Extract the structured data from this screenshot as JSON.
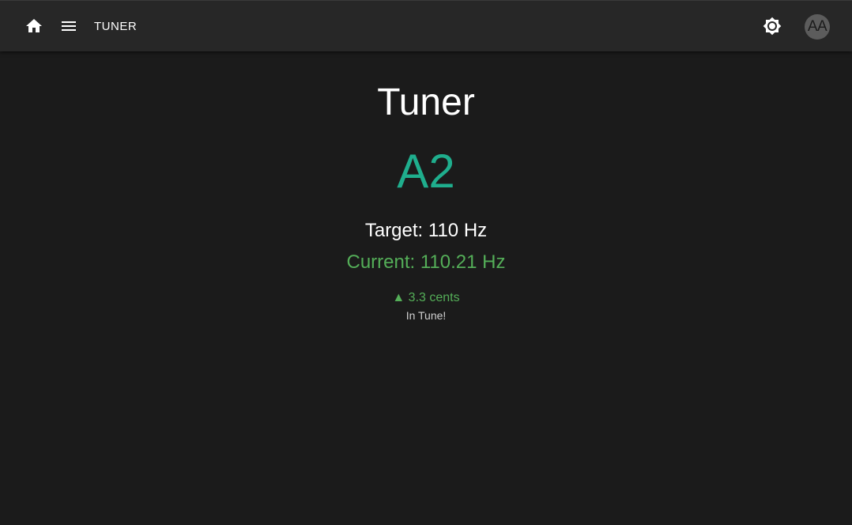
{
  "appbar": {
    "title": "TUNER",
    "home_icon": "home-icon",
    "menu_icon": "menu-icon",
    "theme_icon": "brightness-icon",
    "avatar_initials": "AA"
  },
  "tuner": {
    "title": "Tuner",
    "note": "A2",
    "target": "Target: 110 Hz",
    "current": "Current: 110.21 Hz",
    "cents_arrow": "▲",
    "cents": "3.3 cents",
    "status": "In Tune!"
  },
  "colors": {
    "background": "#1b1b1b",
    "appbar": "#272727",
    "note": "#1fae8d",
    "in_tune": "#54ae58"
  }
}
